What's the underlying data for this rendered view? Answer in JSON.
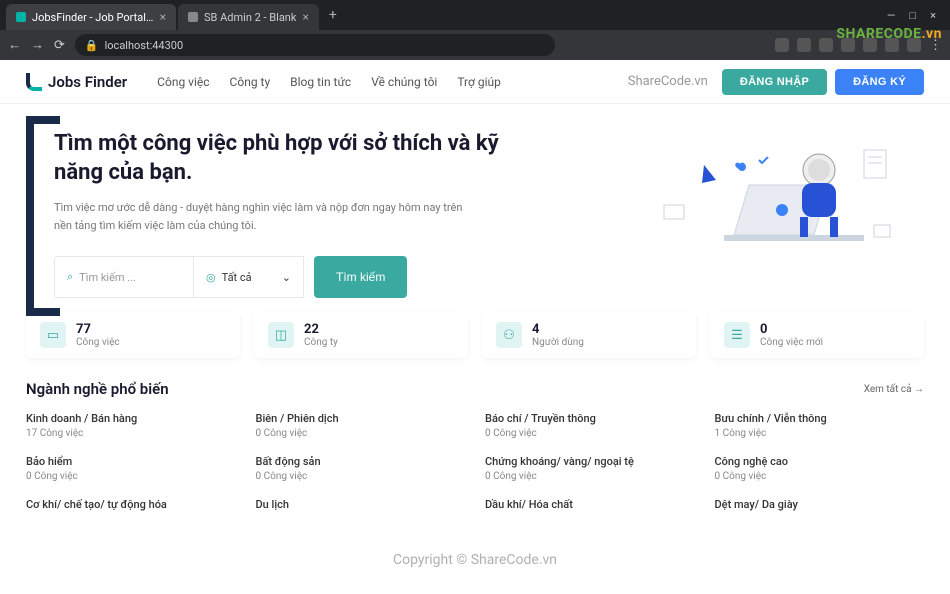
{
  "browser": {
    "tabs": [
      {
        "title": "JobsFinder - Job Portal Website T"
      },
      {
        "title": "SB Admin 2 - Blank"
      }
    ],
    "address": "localhost:44300",
    "window_controls": {
      "min": "—",
      "max": "□",
      "close": "×"
    }
  },
  "watermarks": {
    "sharecode": "SHARECODE",
    "sharecode_ext": ".vn",
    "header_wm": "ShareCode.vn",
    "copyright": "Copyright © ShareCode.vn"
  },
  "nav": {
    "brand": "Jobs Finder",
    "items": [
      "Công việc",
      "Công ty",
      "Blog tin tức",
      "Về chúng tôi",
      "Trợ giúp"
    ],
    "login": "ĐĂNG NHẬP",
    "register": "ĐĂNG KÝ"
  },
  "hero": {
    "title": "Tìm một công việc phù hợp với sở thích và kỹ năng của bạn.",
    "subtitle": "Tìm việc mơ ước dễ dàng - duyệt hàng nghìn việc làm và nộp đơn ngay hôm nay trên nền tảng tìm kiếm việc làm của chúng tôi.",
    "search_placeholder": "Tìm kiếm ...",
    "location_value": "Tất cả",
    "search_button": "Tìm kiếm"
  },
  "stats": [
    {
      "num": "77",
      "label": "Công việc",
      "icon": "briefcase-icon"
    },
    {
      "num": "22",
      "label": "Công ty",
      "icon": "building-icon"
    },
    {
      "num": "4",
      "label": "Người dùng",
      "icon": "users-icon"
    },
    {
      "num": "0",
      "label": "Công việc mới",
      "icon": "document-icon"
    }
  ],
  "categories": {
    "title": "Ngành nghề phổ biến",
    "view_all": "Xem tất cả →",
    "items": [
      {
        "name": "Kinh doanh / Bán hàng",
        "count": "17 Công việc"
      },
      {
        "name": "Biên / Phiên dịch",
        "count": "0 Công việc"
      },
      {
        "name": "Báo chí / Truyền thông",
        "count": "0 Công việc"
      },
      {
        "name": "Bưu chính / Viễn thông",
        "count": "1 Công việc"
      },
      {
        "name": "Bảo hiểm",
        "count": "0 Công việc"
      },
      {
        "name": "Bất động sản",
        "count": "0 Công việc"
      },
      {
        "name": "Chứng khoáng/ vàng/ ngoại tệ",
        "count": "0 Công việc"
      },
      {
        "name": "Công nghệ cao",
        "count": "0 Công việc"
      },
      {
        "name": "Cơ khí/ chế tạo/ tự động hóa",
        "count": ""
      },
      {
        "name": "Du lịch",
        "count": ""
      },
      {
        "name": "Dầu khí/ Hóa chất",
        "count": ""
      },
      {
        "name": "Dệt may/ Da giày",
        "count": ""
      }
    ]
  }
}
